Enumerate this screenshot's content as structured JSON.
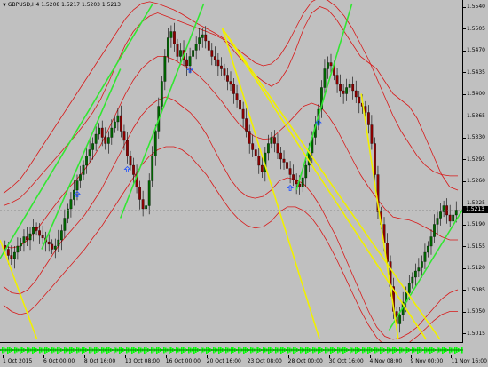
{
  "header": {
    "arrow_icon": "triangle-down-icon",
    "symbol_info": "GBPUSD,H4  1.5208 1.5217 1.5203 1.5213"
  },
  "price_axis": {
    "ticks": [
      "1.5540",
      "1.5505",
      "1.5470",
      "1.5435",
      "1.5400",
      "1.5365",
      "1.5330",
      "1.5295",
      "1.5260",
      "1.5225",
      "1.5190",
      "1.5155",
      "1.5120",
      "1.5085",
      "1.5050",
      "1.5015"
    ],
    "current_price": "1.5213",
    "current_price_color": "#000000"
  },
  "time_axis": {
    "ticks": [
      "1 Oct 2015",
      "6 Oct 00:00",
      "8 Oct 16:00",
      "13 Oct 08:00",
      "16 Oct 00:00",
      "20 Oct 16:00",
      "23 Oct 08:00",
      "28 Oct 00:00",
      "30 Oct 16:00",
      "4 Nov 08:00",
      "9 Nov 00:00",
      "11 Nov 16:00"
    ]
  },
  "colors": {
    "background": "#c0c0c0",
    "bull_candle": "#006400",
    "bear_candle": "#8b0000",
    "bollinger": "#d81818",
    "trend_green": "#32e632",
    "trend_yellow": "#f0f000",
    "signal_arrow": "#1e50ff",
    "indicator_green": "#00ff00"
  },
  "chart_data": {
    "type": "candlestick",
    "symbol": "GBPUSD",
    "timeframe": "H4",
    "last_bar": {
      "open": 1.5208,
      "high": 1.5217,
      "low": 1.5203,
      "close": 1.5213
    },
    "ylim": [
      1.5005,
      1.5545
    ],
    "y_ticks": [
      1.554,
      1.5505,
      1.547,
      1.5435,
      1.54,
      1.5365,
      1.533,
      1.5295,
      1.526,
      1.5225,
      1.519,
      1.5155,
      1.512,
      1.5085,
      1.505,
      1.5015
    ],
    "x_tick_labels": [
      "1 Oct 2015",
      "6 Oct 00:00",
      "8 Oct 16:00",
      "13 Oct 08:00",
      "16 Oct 00:00",
      "20 Oct 16:00",
      "23 Oct 08:00",
      "28 Oct 00:00",
      "30 Oct 16:00",
      "4 Nov 08:00",
      "9 Nov 00:00",
      "11 Nov 16:00"
    ],
    "closes": [
      1.515,
      1.514,
      1.5135,
      1.5145,
      1.5155,
      1.516,
      1.517,
      1.5165,
      1.5175,
      1.5185,
      1.518,
      1.5172,
      1.5168,
      1.5162,
      1.5158,
      1.515,
      1.5155,
      1.5165,
      1.518,
      1.52,
      1.5215,
      1.523,
      1.5245,
      1.526,
      1.527,
      1.5285,
      1.53,
      1.531,
      1.532,
      1.5335,
      1.5345,
      1.533,
      1.532,
      1.533,
      1.5345,
      1.5355,
      1.5365,
      1.534,
      1.5325,
      1.53,
      1.5285,
      1.527,
      1.525,
      1.523,
      1.5215,
      1.522,
      1.526,
      1.53,
      1.534,
      1.538,
      1.542,
      1.546,
      1.549,
      1.55,
      1.548,
      1.546,
      1.547,
      1.5455,
      1.5445,
      1.546,
      1.547,
      1.548,
      1.549,
      1.5495,
      1.5485,
      1.547,
      1.546,
      1.5455,
      1.5445,
      1.544,
      1.543,
      1.542,
      1.5415,
      1.54,
      1.539,
      1.5375,
      1.536,
      1.534,
      1.532,
      1.531,
      1.53,
      1.5285,
      1.5275,
      1.5305,
      1.532,
      1.533,
      1.532,
      1.5305,
      1.5295,
      1.529,
      1.528,
      1.527,
      1.5262,
      1.5255,
      1.525,
      1.5265,
      1.5285,
      1.5305,
      1.533,
      1.535,
      1.5375,
      1.541,
      1.544,
      1.545,
      1.5445,
      1.543,
      1.5415,
      1.5405,
      1.54,
      1.541,
      1.5415,
      1.5405,
      1.5395,
      1.5385,
      1.538,
      1.537,
      1.535,
      1.532,
      1.527,
      1.521,
      1.519,
      1.516,
      1.513,
      1.509,
      1.505,
      1.503,
      1.5045,
      1.5065,
      1.508,
      1.5095,
      1.5105,
      1.5115,
      1.512,
      1.513,
      1.5145,
      1.5155,
      1.517,
      1.519,
      1.52,
      1.521,
      1.522,
      1.5205,
      1.5195,
      1.5205,
      1.5213
    ],
    "series": [
      {
        "name": "price",
        "kind": "candles"
      },
      {
        "name": "bb-upper",
        "kind": "line",
        "values": [
          1.522,
          1.5225,
          1.5232,
          1.5245,
          1.526,
          1.5275,
          1.529,
          1.5305,
          1.532,
          1.5335,
          1.5352,
          1.537,
          1.5392,
          1.542,
          1.545,
          1.5478,
          1.55,
          1.5515,
          1.5525,
          1.553,
          1.5525,
          1.552,
          1.5515,
          1.551,
          1.5505,
          1.55,
          1.5495,
          1.5488,
          1.5475,
          1.546,
          1.5445,
          1.543,
          1.542,
          1.5412,
          1.542,
          1.544,
          1.547,
          1.5505,
          1.553,
          1.554,
          1.5535,
          1.552,
          1.55,
          1.548,
          1.546,
          1.545,
          1.544,
          1.542,
          1.54,
          1.539,
          1.538,
          1.536,
          1.533,
          1.53,
          1.527,
          1.525,
          1.5245
        ]
      },
      {
        "name": "bb-lower",
        "kind": "line",
        "values": [
          1.509,
          1.508,
          1.5078,
          1.5085,
          1.51,
          1.512,
          1.514,
          1.516,
          1.5175,
          1.519,
          1.5205,
          1.5225,
          1.5245,
          1.527,
          1.5295,
          1.532,
          1.5345,
          1.5365,
          1.538,
          1.539,
          1.5395,
          1.539,
          1.538,
          1.537,
          1.5355,
          1.5335,
          1.531,
          1.5285,
          1.5262,
          1.5245,
          1.5235,
          1.5232,
          1.5235,
          1.5245,
          1.526,
          1.5265,
          1.5262,
          1.5255,
          1.524,
          1.522,
          1.5195,
          1.517,
          1.514,
          1.511,
          1.508,
          1.505,
          1.5025,
          1.501,
          1.5005,
          1.5008,
          1.5015,
          1.5025,
          1.504,
          1.5055,
          1.507,
          1.508,
          1.5085
        ]
      },
      {
        "name": "bb-upper-2",
        "kind": "line",
        "values": [
          1.524,
          1.525,
          1.5262,
          1.528,
          1.53,
          1.532,
          1.534,
          1.536,
          1.538,
          1.54,
          1.542,
          1.544,
          1.546,
          1.548,
          1.55,
          1.552,
          1.5535,
          1.5545,
          1.5548,
          1.5545,
          1.554,
          1.5535,
          1.5528,
          1.552,
          1.5512,
          1.5505,
          1.5498,
          1.549,
          1.548,
          1.547,
          1.546,
          1.545,
          1.5445,
          1.5448,
          1.546,
          1.548,
          1.5505,
          1.553,
          1.5548,
          1.5555,
          1.555,
          1.554,
          1.5525,
          1.5505,
          1.548,
          1.5455,
          1.5425,
          1.5395,
          1.5365,
          1.534,
          1.532,
          1.53,
          1.5285,
          1.5275,
          1.527,
          1.5268,
          1.5268
        ]
      },
      {
        "name": "bb-lower-2",
        "kind": "line",
        "values": [
          1.506,
          1.505,
          1.5045,
          1.5048,
          1.506,
          1.5075,
          1.509,
          1.5105,
          1.512,
          1.5135,
          1.515,
          1.5168,
          1.5185,
          1.5205,
          1.5225,
          1.5245,
          1.5265,
          1.5285,
          1.53,
          1.531,
          1.5315,
          1.5315,
          1.531,
          1.53,
          1.5285,
          1.527,
          1.525,
          1.523,
          1.5212,
          1.5198,
          1.5188,
          1.5184,
          1.5186,
          1.5195,
          1.521,
          1.5218,
          1.5218,
          1.5212,
          1.52,
          1.5182,
          1.516,
          1.5135,
          1.5108,
          1.508,
          1.5052,
          1.5028,
          1.5008,
          1.4995,
          1.499,
          1.4992,
          1.5,
          1.501,
          1.5022,
          1.5035,
          1.5045,
          1.505,
          1.505
        ]
      },
      {
        "name": "bb-mid",
        "kind": "line",
        "values": [
          1.5155,
          1.5152,
          1.5155,
          1.5165,
          1.518,
          1.5197,
          1.5215,
          1.5232,
          1.5248,
          1.5262,
          1.5278,
          1.5297,
          1.5318,
          1.5345,
          1.5372,
          1.5399,
          1.5422,
          1.544,
          1.5452,
          1.546,
          1.546,
          1.5455,
          1.5447,
          1.544,
          1.543,
          1.5417,
          1.5402,
          1.5386,
          1.5368,
          1.5352,
          1.534,
          1.5331,
          1.5327,
          1.5328,
          1.534,
          1.5352,
          1.5366,
          1.538,
          1.5385,
          1.538,
          1.5365,
          1.5345,
          1.532,
          1.5295,
          1.527,
          1.525,
          1.5232,
          1.5215,
          1.5202,
          1.5199,
          1.5197,
          1.5192,
          1.5185,
          1.5178,
          1.517,
          1.5165,
          1.5165
        ]
      }
    ],
    "trend_lines": [
      {
        "color": "green",
        "from": [
          0,
          1.5135
        ],
        "to": [
          0.33,
          1.5545
        ]
      },
      {
        "color": "green",
        "from": [
          0.09,
          1.515
        ],
        "to": [
          0.26,
          1.544
        ]
      },
      {
        "color": "green",
        "from": [
          0.26,
          1.52
        ],
        "to": [
          0.44,
          1.5545
        ]
      },
      {
        "color": "green",
        "from": [
          0.64,
          1.5245
        ],
        "to": [
          0.76,
          1.5545
        ]
      },
      {
        "color": "green",
        "from": [
          0.84,
          1.502
        ],
        "to": [
          1.0,
          1.5215
        ]
      },
      {
        "color": "yellow",
        "from": [
          0.48,
          1.5505
        ],
        "to": [
          0.69,
          1.5005
        ]
      },
      {
        "color": "yellow",
        "from": [
          0.48,
          1.5505
        ],
        "to": [
          0.92,
          1.5005
        ]
      },
      {
        "color": "yellow",
        "from": [
          0.48,
          1.5505
        ],
        "to": [
          0.95,
          1.5005
        ]
      },
      {
        "color": "yellow",
        "from": [
          0.78,
          1.54
        ],
        "to": [
          0.86,
          1.5005
        ]
      },
      {
        "color": "yellow",
        "from": [
          0,
          1.5165
        ],
        "to": [
          0.08,
          1.5005
        ]
      }
    ],
    "signal_arrows_at_index": [
      23,
      39,
      59,
      91,
      100
    ],
    "grid": false
  }
}
